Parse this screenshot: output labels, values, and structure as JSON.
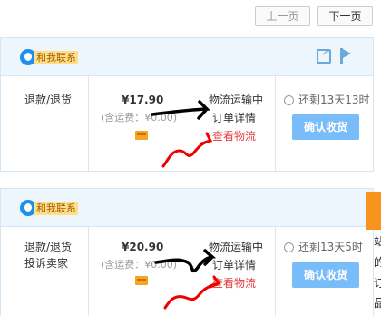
{
  "pager": {
    "prev": "上一页",
    "next": "下一页"
  },
  "orders": [
    {
      "contact": "和我联系",
      "actions": [
        "退款/退货"
      ],
      "price": "¥17.90",
      "shipping": "(含运费：¥0.00)",
      "logistics_status": "物流运输中",
      "order_detail": "订单详情",
      "view_logistics": "查看物流",
      "remaining": "还剩13天13时",
      "confirm": "确认收货"
    },
    {
      "contact": "和我联系",
      "actions": [
        "退款/退货",
        "投诉卖家"
      ],
      "price": "¥20.90",
      "shipping": "(含运费：¥0.00)",
      "logistics_status": "物流运输中",
      "order_detail": "订单详情",
      "view_logistics": "查看物流",
      "remaining": "还剩13天5时",
      "confirm": "确认收货"
    }
  ],
  "colors": {
    "accent": "#79bcfa",
    "link_red": "#e4393c",
    "header_bg": "#eef6fd",
    "side_orange": "#f7931e"
  },
  "icons": [
    "qq-icon",
    "share-icon",
    "flag-icon",
    "bank-card-icon",
    "clock-icon"
  ],
  "side_chars": [
    "站",
    "的",
    "订",
    "品"
  ]
}
